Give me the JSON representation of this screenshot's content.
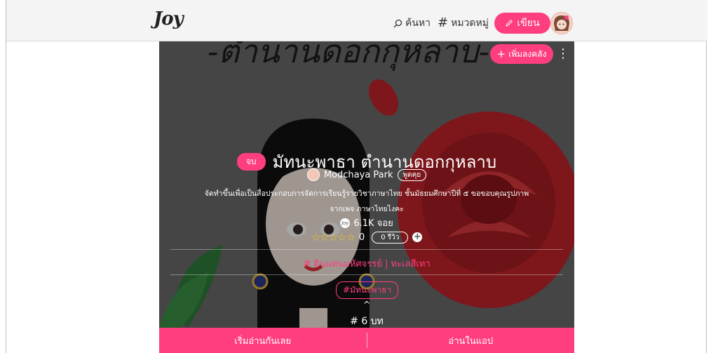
{
  "header": {
    "logo": "Joy",
    "search_label": "ค้นหา",
    "category_label": "หมวดหมู่",
    "write_label": "เขียน"
  },
  "hero": {
    "cover_text": "-ตำนานดอกกุหลาบ-",
    "add_shelf_label": "เพิ่มลงคลัง",
    "end_badge": "จบ",
    "title": "มัทนะพาธา ตำนานดอกกุหลาบ",
    "author": "Modchaya Park",
    "talk_label": "พูดคุย",
    "description_line1": "จัดทำขึ้นเพื่อเป็นสื่อประกอบการจัดการเรียนรู้รายวิชาภาษาไทย ชั้นมัธยมศึกษาปีที่ ๕ ขอขอบคุณรูปภาพ",
    "description_line2": "จากเพจ ภาษาไทยไงคะ",
    "joy_count": "6.1K จอย",
    "stars": "☆☆☆☆☆",
    "rating": "0",
    "reviews_label": "0 รีวิว",
    "categories": "# ดินแดนมหัศจรรย์ | ทะเลสีเทา",
    "tag": "#มัทนะพาธา",
    "caret": "^",
    "episodes": "# 6 บท"
  },
  "bottom": {
    "read_now": "เริ่มอ่านกันเลย",
    "read_in_app": "อ่านในแอป"
  },
  "colors": {
    "accent": "#ff3e7f",
    "topbar": "#f4f4f4",
    "star": "#f5c518"
  }
}
